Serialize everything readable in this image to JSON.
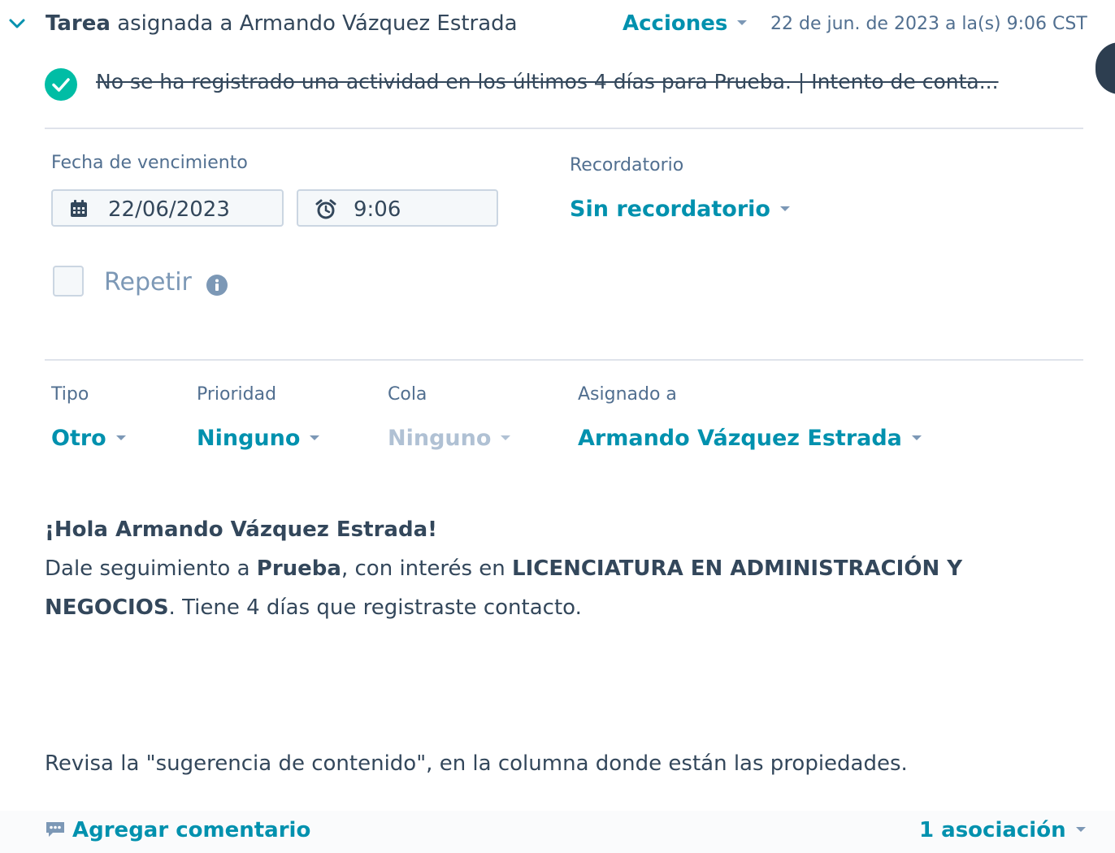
{
  "header": {
    "title_bold": "Tarea",
    "title_rest": "asignada a Armando Vázquez Estrada",
    "actions_label": "Acciones",
    "timestamp": "22 de jun. de 2023 a la(s) 9:06 CST"
  },
  "task": {
    "title": "No se ha registrado una actividad en los últimos 4 días para Prueba. | Intento de conta...",
    "completed": true
  },
  "due": {
    "label": "Fecha de vencimiento",
    "date": "22/06/2023",
    "time": "9:06"
  },
  "reminder": {
    "label": "Recordatorio",
    "value": "Sin recordatorio"
  },
  "repeat": {
    "label": "Repetir",
    "checked": false
  },
  "properties": {
    "type_label": "Tipo",
    "type_value": "Otro",
    "priority_label": "Prioridad",
    "priority_value": "Ninguno",
    "queue_label": "Cola",
    "queue_value": "Ninguno",
    "assigned_label": "Asignado a",
    "assigned_value": "Armando Vázquez Estrada"
  },
  "notes": {
    "greeting": "¡Hola Armando Vázquez Estrada!",
    "line1_a": "Dale seguimiento a ",
    "line1_b": "Prueba",
    "line1_c": ", con interés en ",
    "line1_d": "LICENCIATURA EN ADMINISTRACIÓN Y",
    "line2_a": "NEGOCIOS",
    "line2_b": ". Tiene 4 días que registraste contacto.",
    "line3": "Revisa la \"sugerencia de contenido\", en la columna donde están las propiedades."
  },
  "footer": {
    "comment_label": "Agregar comentario",
    "associations_label": "1 asociación"
  },
  "colors": {
    "accent": "#0091ae",
    "success": "#00bda5",
    "text": "#33475b",
    "muted": "#7c98b6"
  }
}
